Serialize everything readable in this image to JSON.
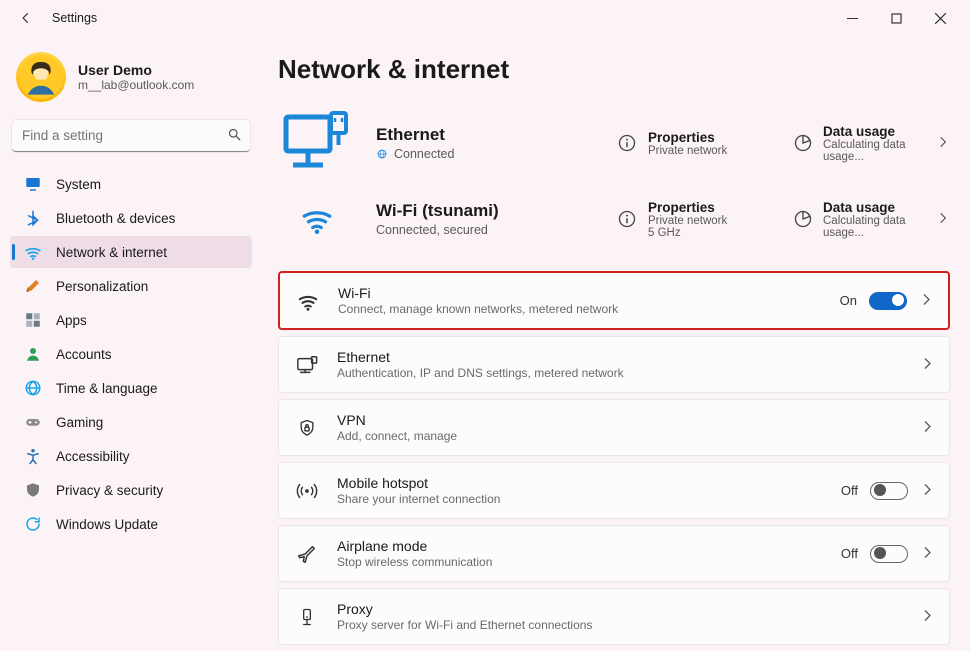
{
  "app_title": "Settings",
  "user": {
    "name": "User Demo",
    "email": "m__lab@outlook.com"
  },
  "search": {
    "placeholder": "Find a setting"
  },
  "sidebar": {
    "items": [
      {
        "label": "System",
        "icon": "system",
        "color": "#1976d2"
      },
      {
        "label": "Bluetooth & devices",
        "icon": "bluetooth",
        "color": "#1976d2"
      },
      {
        "label": "Network & internet",
        "icon": "wifi",
        "color": "#1aa3e8",
        "selected": true
      },
      {
        "label": "Personalization",
        "icon": "brush",
        "color": "#e67e22"
      },
      {
        "label": "Apps",
        "icon": "apps",
        "color": "#556"
      },
      {
        "label": "Accounts",
        "icon": "person",
        "color": "#2e9e5b"
      },
      {
        "label": "Time & language",
        "icon": "globe",
        "color": "#1aa3e8"
      },
      {
        "label": "Gaming",
        "icon": "gaming",
        "color": "#8a8a8a"
      },
      {
        "label": "Accessibility",
        "icon": "accessibility",
        "color": "#2b6fb3"
      },
      {
        "label": "Privacy & security",
        "icon": "shield",
        "color": "#7a7a7a"
      },
      {
        "label": "Windows Update",
        "icon": "update",
        "color": "#1aa3e8"
      }
    ]
  },
  "page": {
    "title": "Network & internet",
    "status_cards": [
      {
        "id": "ethernet-status",
        "icon": "ethernet-large",
        "title": "Ethernet",
        "sub": "Connected",
        "sub_icon": "globe-small",
        "properties": {
          "title": "Properties",
          "sub": "Private network"
        },
        "data_usage": {
          "title": "Data usage",
          "sub": "Calculating data usage..."
        }
      },
      {
        "id": "wifi-status",
        "icon": "wifi-large",
        "title": "Wi-Fi (tsunami)",
        "sub": "Connected, secured",
        "properties": {
          "title": "Properties",
          "sub": "Private network\n5 GHz"
        },
        "data_usage": {
          "title": "Data usage",
          "sub": "Calculating data usage..."
        }
      }
    ],
    "settings": [
      {
        "id": "wifi",
        "icon": "wifi",
        "title": "Wi-Fi",
        "sub": "Connect, manage known networks, metered network",
        "toggle_state": "On",
        "highlight": true
      },
      {
        "id": "ethernet",
        "icon": "ethernet-small",
        "title": "Ethernet",
        "sub": "Authentication, IP and DNS settings, metered network"
      },
      {
        "id": "vpn",
        "icon": "shield-lock",
        "title": "VPN",
        "sub": "Add, connect, manage"
      },
      {
        "id": "hotspot",
        "icon": "hotspot",
        "title": "Mobile hotspot",
        "sub": "Share your internet connection",
        "toggle_state": "Off"
      },
      {
        "id": "airplane",
        "icon": "airplane",
        "title": "Airplane mode",
        "sub": "Stop wireless communication",
        "toggle_state": "Off"
      },
      {
        "id": "proxy",
        "icon": "proxy",
        "title": "Proxy",
        "sub": "Proxy server for Wi-Fi and Ethernet connections"
      }
    ]
  }
}
